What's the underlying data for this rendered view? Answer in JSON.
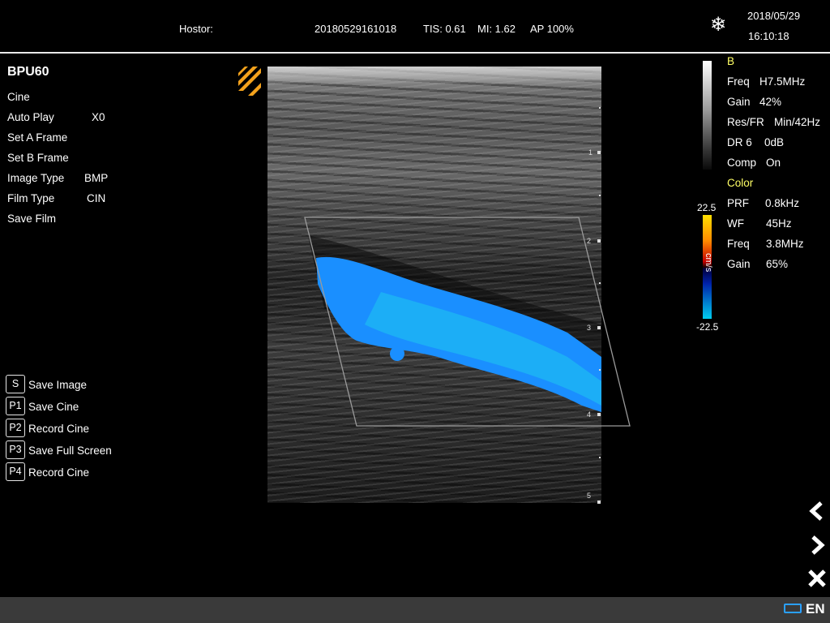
{
  "header": {
    "host_label": "Hostor:",
    "exam_id": "20180529161018",
    "tis": "TIS: 0.61",
    "mi": "MI: 1.62",
    "ap": "AP 100%",
    "date": "2018/05/29",
    "time": "16:10:18",
    "freeze_icon": "snowflake-icon"
  },
  "left_panel": {
    "probe": "BPU60",
    "menu": [
      {
        "label": "Cine",
        "value": ""
      },
      {
        "label": "Auto Play",
        "value": "X0"
      },
      {
        "label": "Set A Frame",
        "value": ""
      },
      {
        "label": "Set B Frame",
        "value": ""
      },
      {
        "label": "Image Type",
        "value": "BMP"
      },
      {
        "label": "Film Type",
        "value": "CIN"
      },
      {
        "label": "Save Film",
        "value": ""
      }
    ],
    "shortcuts": [
      {
        "key": "S",
        "label": "Save Image"
      },
      {
        "key": "P1",
        "label": "Save Cine"
      },
      {
        "key": "P2",
        "label": "Record Cine"
      },
      {
        "key": "P3",
        "label": "Save Full Screen"
      },
      {
        "key": "P4",
        "label": "Record Cine"
      }
    ]
  },
  "image": {
    "depth_marks": [
      "1",
      "2",
      "3",
      "4",
      "5"
    ],
    "color_flow_color": "#1e90ff"
  },
  "right_panel": {
    "b_mode_title": "B",
    "b_params": [
      {
        "label": "Freq",
        "value": "H7.5MHz"
      },
      {
        "label": "Gain",
        "value": "42%"
      },
      {
        "label": "Res/FR",
        "value": "Min/42Hz"
      },
      {
        "label": "DR 6",
        "value": "0dB"
      },
      {
        "label": "Comp",
        "value": "On"
      }
    ],
    "color_title": "Color",
    "color_params": [
      {
        "label": "PRF",
        "value": "0.8kHz"
      },
      {
        "label": "WF",
        "value": "45Hz"
      },
      {
        "label": "Freq",
        "value": "3.8MHz"
      },
      {
        "label": "Gain",
        "value": "65%"
      }
    ],
    "color_bar_max": "22.5",
    "color_bar_min": "-22.5",
    "color_bar_unit": "cm/s"
  },
  "nav": {
    "prev_icon": "chevron-left-icon",
    "next_icon": "chevron-right-icon",
    "close_icon": "close-icon"
  },
  "status": {
    "battery_icon": "battery-icon",
    "language": "EN",
    "accent_color": "#2aa0ff"
  }
}
